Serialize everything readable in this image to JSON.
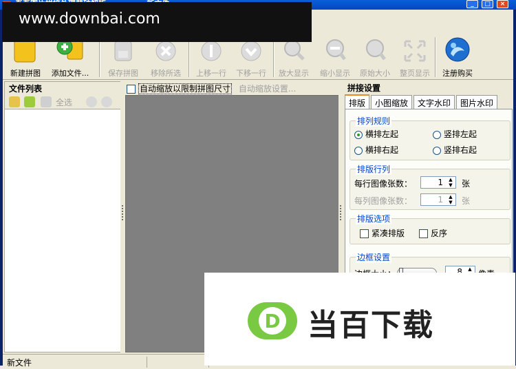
{
  "window": {
    "title_left": "吾吾图片拼接处理器破解版",
    "title_doc": "- 新文件"
  },
  "watermark_top": {
    "text": "www.downbai.com"
  },
  "watermark_bottom": {
    "brand": "当百下载",
    "logo_letter": "D"
  },
  "toolbar": {
    "items": [
      {
        "label": "新建拼图",
        "icon": "new-collage-icon",
        "enabled": true
      },
      {
        "label": "添加文件...",
        "icon": "add-file-icon",
        "enabled": true
      },
      {
        "label": "保存拼图",
        "icon": "save-icon",
        "enabled": false
      },
      {
        "label": "移除所选",
        "icon": "remove-icon",
        "enabled": false
      },
      {
        "label": "上移一行",
        "icon": "move-up-icon",
        "enabled": false
      },
      {
        "label": "下移一行",
        "icon": "move-down-icon",
        "enabled": false
      },
      {
        "label": "放大显示",
        "icon": "zoom-in-icon",
        "enabled": false
      },
      {
        "label": "缩小显示",
        "icon": "zoom-out-icon",
        "enabled": false
      },
      {
        "label": "原始大小",
        "icon": "actual-size-icon",
        "enabled": false
      },
      {
        "label": "整页显示",
        "icon": "fit-page-icon",
        "enabled": false
      },
      {
        "label": "注册购买",
        "icon": "register-buy-icon",
        "enabled": true
      }
    ]
  },
  "file_list": {
    "title": "文件列表",
    "select_all": "全选"
  },
  "center": {
    "auto_scale_label": "自动缩放以限制拼图尺寸",
    "auto_scale_settings": "自动缩放设置..."
  },
  "settings": {
    "title": "拼接设置",
    "tabs": [
      "排版",
      "小图缩放",
      "文字水印",
      "图片水印"
    ],
    "layout_rule": {
      "title": "排列规则",
      "options": [
        "横排左起",
        "竖排左起",
        "横排右起",
        "竖排右起"
      ],
      "selected": "横排左起"
    },
    "rows_cols": {
      "title": "排版行列",
      "per_row_label": "每行图像张数：",
      "per_row_value": "1",
      "per_col_label": "每列图像张数：",
      "per_col_value": "1",
      "unit": "张"
    },
    "options": {
      "title": "排版选项",
      "compact": "紧凑排版",
      "reverse": "反序"
    },
    "border": {
      "title": "边框设置",
      "size_label": "边框大小：",
      "size_value": "8",
      "unit": "像素"
    }
  },
  "status": {
    "left": "新文件"
  }
}
